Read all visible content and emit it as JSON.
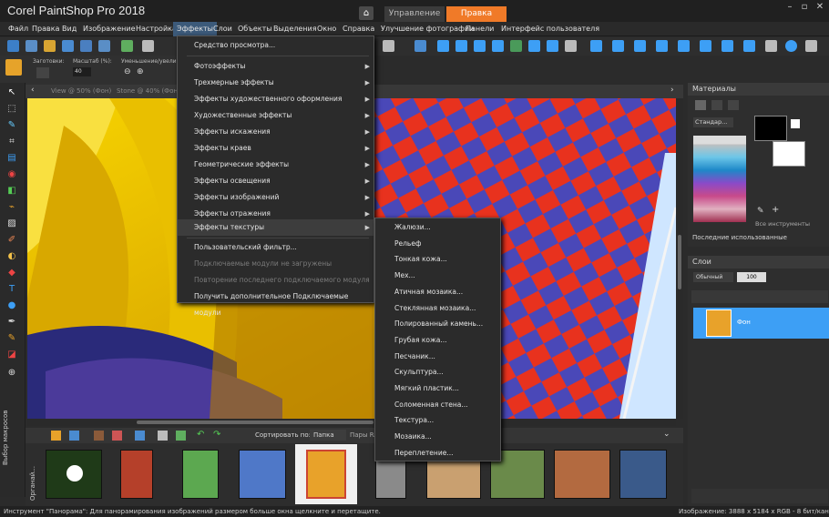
{
  "app": {
    "title": "Corel PaintShop Pro 2018"
  },
  "tabs": {
    "manage": "Управление",
    "edit": "Правка"
  },
  "menu": [
    "Файл",
    "Правка",
    "Вид",
    "Изображение",
    "Настройка",
    "Эффекты",
    "Слои",
    "Объекты",
    "Выделения",
    "Окно",
    "Справка",
    "Улучшение фотографии",
    "Панели",
    "Интерфейс пользователя"
  ],
  "tool_options": {
    "preset": "Заготовки:",
    "zoom_label": "Масштаб (%):",
    "zoom_value": "40",
    "zoom_more": "Уменьшение/увеличе"
  },
  "doc_tabs": {
    "view": "View @  50% (Фон)",
    "stone": "Stone @  40% (Фон)"
  },
  "effects_menu": [
    {
      "label": "Средство просмотра...",
      "sub": false,
      "disabled": false
    },
    {
      "label": "Фотоэффекты",
      "sub": true,
      "disabled": false
    },
    {
      "label": "Трехмерные эффекты",
      "sub": true,
      "disabled": false
    },
    {
      "label": "Эффекты художественного оформления",
      "sub": true,
      "disabled": false
    },
    {
      "label": "Художественные эффекты",
      "sub": true,
      "disabled": false
    },
    {
      "label": "Эффекты искажения",
      "sub": true,
      "disabled": false
    },
    {
      "label": "Эффекты краев",
      "sub": true,
      "disabled": false
    },
    {
      "label": "Геометрические эффекты",
      "sub": true,
      "disabled": false
    },
    {
      "label": "Эффекты освещения",
      "sub": true,
      "disabled": false
    },
    {
      "label": "Эффекты изображений",
      "sub": true,
      "disabled": false
    },
    {
      "label": "Эффекты отражения",
      "sub": true,
      "disabled": false
    },
    {
      "label": "Эффекты текстуры",
      "sub": true,
      "disabled": false
    },
    {
      "label": "Пользовательский фильтр...",
      "sub": false,
      "disabled": false
    },
    {
      "label": "Подключаемые модули не загружены",
      "sub": false,
      "disabled": true
    },
    {
      "label": "Повторение последнего подключаемого модуля",
      "sub": false,
      "disabled": true
    },
    {
      "label": "Получить дополнительное Подключаемые модули",
      "sub": false,
      "disabled": false
    }
  ],
  "texture_submenu": [
    "Жалюзи...",
    "Рельеф",
    "Тонкая кожа...",
    "Мех...",
    "Атичная мозаика...",
    "Стеклянная мозаика...",
    "Полированный камень...",
    "Грубая кожа...",
    "Песчаник...",
    "Скульптура...",
    "Мягкий пластик...",
    "Соломенная стена...",
    "Текстура...",
    "Мозаика...",
    "Переплетение..."
  ],
  "organizer": {
    "sort_label": "Сортировать по:",
    "sort_value": "Папка",
    "pairs_label": "Пары RA",
    "side_label": "Органай...",
    "side_label2": "Выбор макросов"
  },
  "materials": {
    "title": "Материалы",
    "mode": "Стандар...",
    "all_tools": "Все инструменты",
    "recent": "Последние использованные"
  },
  "layers": {
    "title": "Слои",
    "blend": "Обычный",
    "opacity": "100",
    "layer_name": "Фон"
  },
  "status": {
    "left": "Инструмент \"Панорама\": Для панорамирования изображений размером больше окна щелкните и перетащите.",
    "right": "Изображение:  3888 x 5184 x RGB - 8 бит/канал"
  },
  "colors": {
    "accent": "#f07a28",
    "highlight": "#3d9ff5"
  }
}
